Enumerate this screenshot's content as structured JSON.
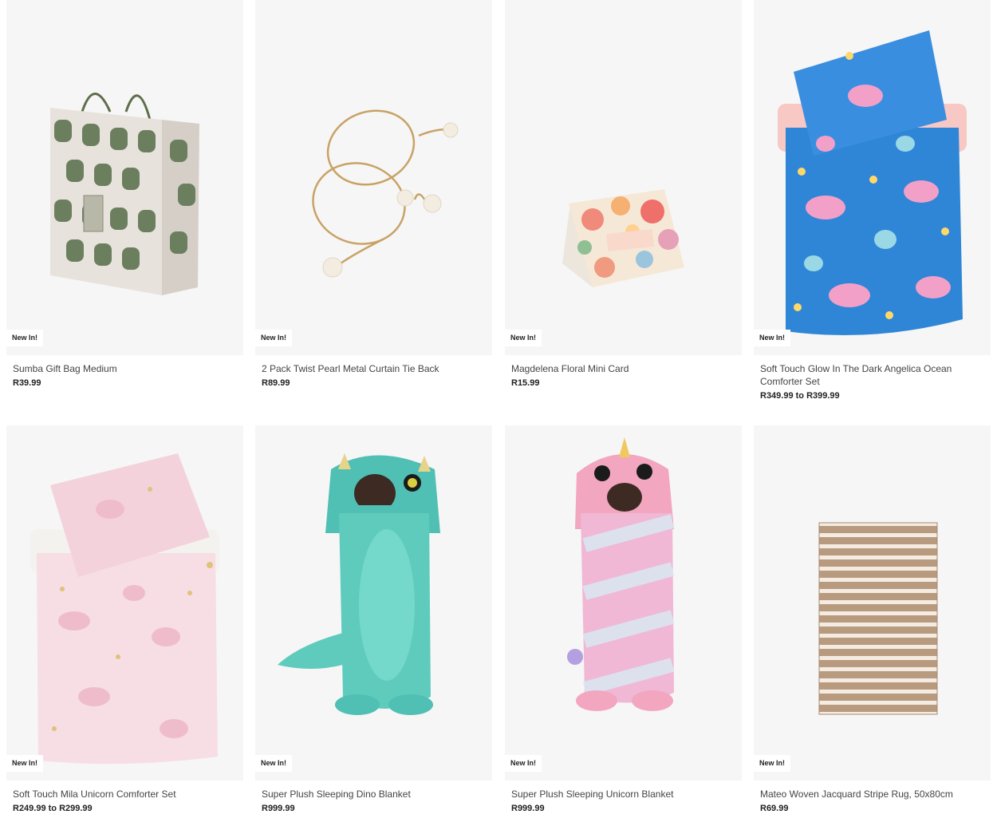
{
  "products": [
    {
      "badge": "New In!",
      "title": "Sumba Gift Bag Medium",
      "price": "R39.99",
      "image": "gift-bag"
    },
    {
      "badge": "New In!",
      "title": "2 Pack Twist Pearl Metal Curtain Tie Back",
      "price": "R89.99",
      "image": "curtain-tie-back"
    },
    {
      "badge": "New In!",
      "title": "Magdelena Floral Mini Card",
      "price": "R15.99",
      "image": "floral-card"
    },
    {
      "badge": "New In!",
      "title": "Soft Touch Glow In The Dark Angelica Ocean Comforter Set",
      "price": "R349.99 to R399.99",
      "image": "ocean-comforter"
    },
    {
      "badge": "New In!",
      "title": "Soft Touch Mila Unicorn Comforter Set",
      "price": "R249.99 to R299.99",
      "image": "unicorn-comforter"
    },
    {
      "badge": "New In!",
      "title": "Super Plush Sleeping Dino Blanket",
      "price": "R999.99",
      "image": "dino-blanket"
    },
    {
      "badge": "New In!",
      "title": "Super Plush Sleeping Unicorn Blanket",
      "price": "R999.99",
      "image": "unicorn-blanket"
    },
    {
      "badge": "New In!",
      "title": "Mateo Woven Jacquard Stripe Rug, 50x80cm",
      "price": "R69.99",
      "image": "stripe-rug"
    }
  ]
}
